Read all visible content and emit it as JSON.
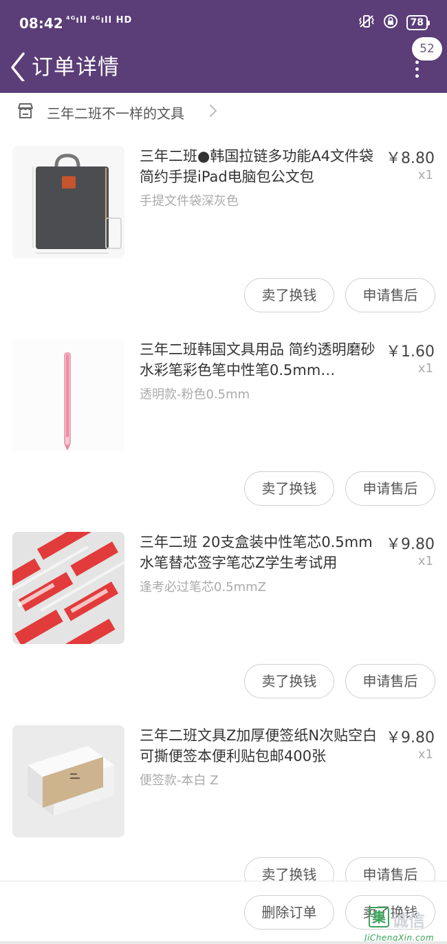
{
  "status_bar": {
    "time": "08:42",
    "signals": "⁴ᴳıll ⁴ᴳıll HD",
    "battery": "78"
  },
  "header": {
    "back_icon": "chevron-left-icon",
    "title": "订单详情",
    "badge_count": "52",
    "more_icon": "more-vertical-icon",
    "background_color": "#5b3d78"
  },
  "shop": {
    "icon": "store-icon",
    "name": "三年二班不一样的文具"
  },
  "items": [
    {
      "title": "三年二班●韩国拉链多功能A4文件袋 简约手提iPad电脑包公文包",
      "sku": "手提文件袋深灰色",
      "price": "￥8.80",
      "qty": "x1",
      "image": "gray-document-bag",
      "sell_label": "卖了换钱",
      "aftersale_label": "申请售后"
    },
    {
      "title": "三年二班韩国文具用品 简约透明磨砂水彩笔彩色笔中性笔0.5mm…",
      "sku": "透明款-粉色0.5mm",
      "price": "￥1.60",
      "qty": "x1",
      "image": "pink-gel-pen",
      "sell_label": "卖了换钱",
      "aftersale_label": "申请售后"
    },
    {
      "title": "三年二班 20支盒装中性笔芯0.5mm水笔替芯签字笔芯Z学生考试用",
      "sku": "逢考必过笔芯0.5mmZ",
      "price": "￥9.80",
      "qty": "x1",
      "image": "red-pen-refill-boxes",
      "sell_label": "卖了换钱",
      "aftersale_label": "申请售后"
    },
    {
      "title": "三年二班文具Z加厚便签纸N次贴空白可撕便签本便利贴包邮400张",
      "sku": "便签款-本白 Z",
      "price": "￥9.80",
      "qty": "x1",
      "image": "sticky-note-pad",
      "sell_label": "卖了换钱",
      "aftersale_label": "申请售后"
    }
  ],
  "footer": {
    "delete_label": "删除订单",
    "sell_label": "卖了换钱"
  },
  "watermark": {
    "logo_char": "集",
    "text": "诚信",
    "url": "JiChengXin.com"
  }
}
